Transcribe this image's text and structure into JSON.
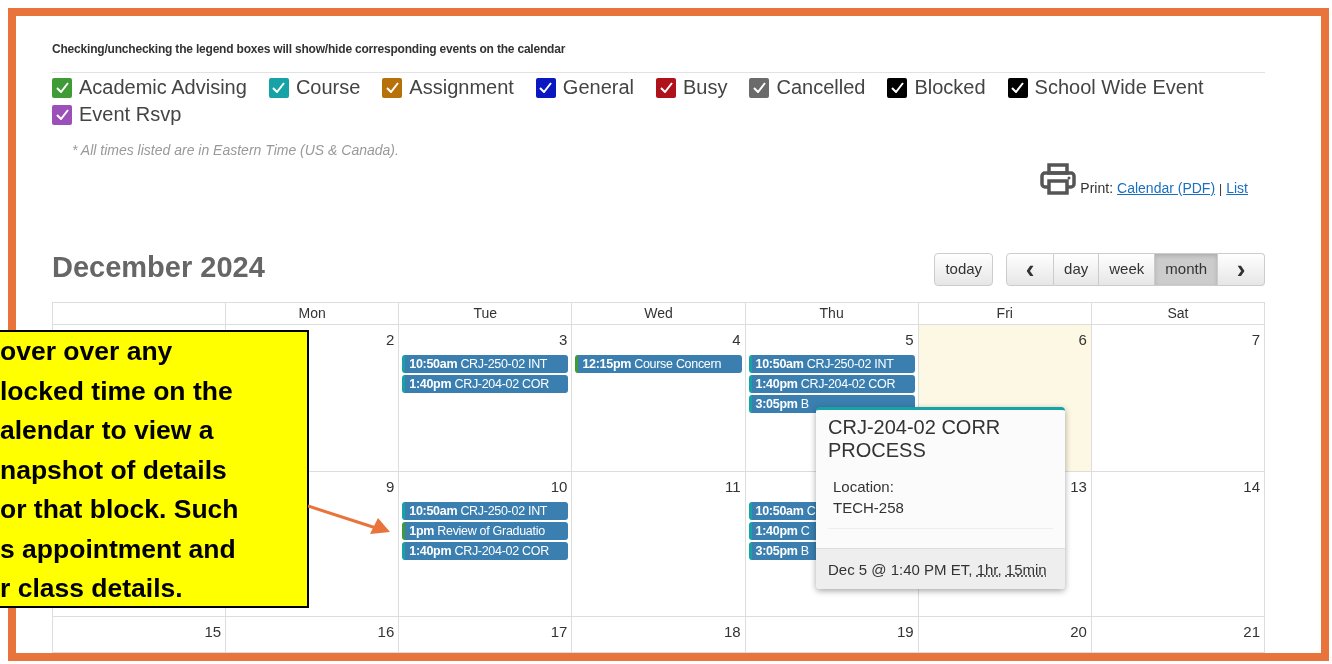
{
  "legend": {
    "instruction": "Checking/unchecking the legend boxes will show/hide corresponding events on the calendar",
    "items": [
      {
        "label": "Academic Advising",
        "color": "#3f9b35",
        "checked": true
      },
      {
        "label": "Course",
        "color": "#17a3a5",
        "checked": true
      },
      {
        "label": "Assignment",
        "color": "#b8700a",
        "checked": true
      },
      {
        "label": "General",
        "color": "#0a18c0",
        "checked": true
      },
      {
        "label": "Busy",
        "color": "#b0121b",
        "checked": true
      },
      {
        "label": "Cancelled",
        "color": "#6b6b6b",
        "checked": true
      },
      {
        "label": "Blocked",
        "color": "#000000",
        "checked": true
      },
      {
        "label": "School Wide Event",
        "color": "#000000",
        "checked": true
      },
      {
        "label": "Event Rsvp",
        "color": "#9b4fb8",
        "checked": true
      }
    ]
  },
  "timezone_note": "* All times listed are in Eastern Time (US & Canada).",
  "print": {
    "label": "Print:",
    "links": [
      "Calendar (PDF)",
      "List"
    ],
    "separator": "|"
  },
  "calendar": {
    "title": "December 2024",
    "toolbar": {
      "today": "today",
      "prev": "‹",
      "next": "›",
      "views": [
        {
          "label": "day",
          "selected": false
        },
        {
          "label": "week",
          "selected": false
        },
        {
          "label": "month",
          "selected": true
        }
      ]
    },
    "columns": [
      "Mon",
      "Tue",
      "Wed",
      "Thu",
      "Fri",
      "Sat"
    ],
    "weeks": [
      {
        "days": [
          {
            "date": "2"
          },
          {
            "date": "3",
            "events": [
              {
                "time": "10:50am",
                "title": "CRJ-250-02 INT",
                "color": "#17a3a5"
              },
              {
                "time": "1:40pm",
                "title": "CRJ-204-02 COR",
                "color": "#17a3a5"
              }
            ]
          },
          {
            "date": "4",
            "events": [
              {
                "time": "12:15pm",
                "title": "Course Concern",
                "color": "#3f9b35"
              }
            ]
          },
          {
            "date": "5",
            "events": [
              {
                "time": "10:50am",
                "title": "CRJ-250-02 INT",
                "color": "#17a3a5"
              },
              {
                "time": "1:40pm",
                "title": "CRJ-204-02 COR",
                "color": "#17a3a5"
              },
              {
                "time": "3:05pm",
                "title": "B",
                "color": "#17a3a5"
              }
            ]
          },
          {
            "date": "6",
            "today": true
          },
          {
            "date": "7"
          }
        ]
      },
      {
        "days": [
          {
            "date": "9"
          },
          {
            "date": "10",
            "events": [
              {
                "time": "10:50am",
                "title": "CRJ-250-02 INT",
                "color": "#17a3a5"
              },
              {
                "time": "1pm",
                "title": "Review of Graduatio",
                "color": "#3f9b35"
              },
              {
                "time": "1:40pm",
                "title": "CRJ-204-02 COR",
                "color": "#17a3a5"
              }
            ]
          },
          {
            "date": "11"
          },
          {
            "events": [
              {
                "time": "10:50am",
                "title": "C",
                "color": "#17a3a5"
              },
              {
                "time": "1:40pm",
                "title": "C",
                "color": "#17a3a5"
              },
              {
                "time": "3:05pm",
                "title": "B",
                "color": "#17a3a5"
              }
            ]
          },
          {
            "date": "13"
          },
          {
            "date": "14"
          }
        ]
      },
      {
        "days": [
          {
            "date": "15"
          },
          {
            "date": "16"
          },
          {
            "date": "17"
          },
          {
            "date": "18"
          },
          {
            "date": "19"
          },
          {
            "date": "20"
          },
          {
            "date": "21"
          }
        ]
      }
    ]
  },
  "popover": {
    "title": "CRJ-204-02 CORR PROCESS",
    "location_label": "Location:",
    "location": "TECH-258",
    "when": "Dec 5 @ 1:40 PM ET,",
    "duration": [
      "1hr,",
      "15min"
    ],
    "color": "#17a3a5"
  },
  "callout": {
    "text": "over over any\nlocked time on the\nalendar to view a\nnapshot of details\nor that block. Such\ns appointment and\nr class details."
  }
}
